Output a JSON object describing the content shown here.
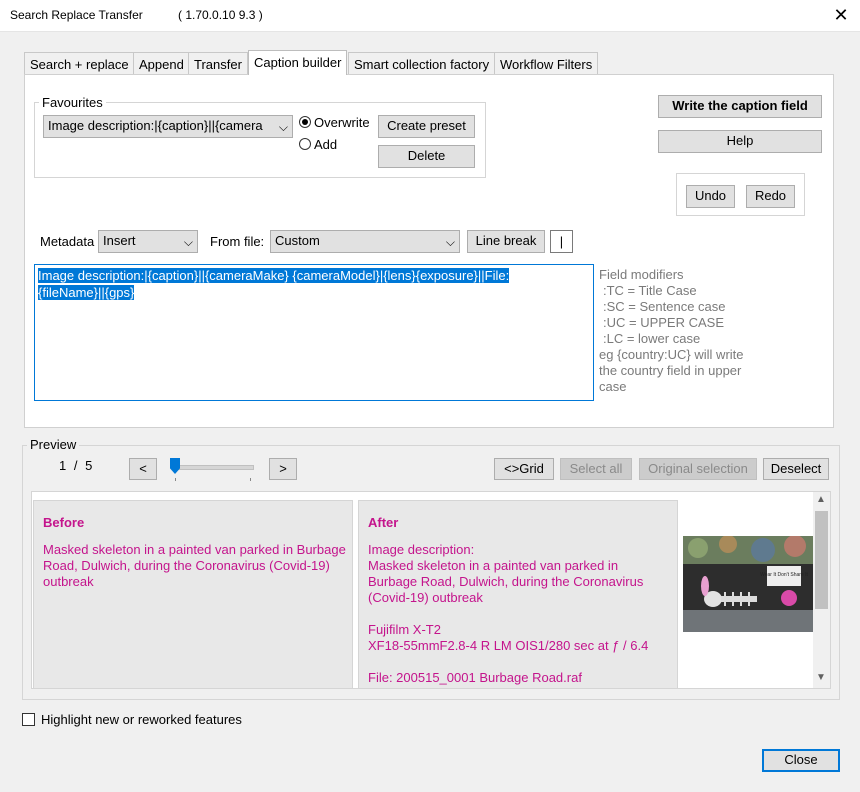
{
  "window": {
    "title": "Search Replace Transfer",
    "version": "( 1.70.0.10 9.3 )",
    "close_glyph": "✕"
  },
  "tabs": [
    {
      "label": "Search + replace"
    },
    {
      "label": "Append"
    },
    {
      "label": "Transfer"
    },
    {
      "label": "Caption builder",
      "active": true
    },
    {
      "label": "Smart collection factory"
    },
    {
      "label": "Workflow Filters"
    }
  ],
  "favourites": {
    "legend": "Favourites",
    "selected": "Image description:|{caption}||{camera",
    "overwrite_label": "Overwrite",
    "add_label": "Add",
    "create_preset": "Create preset",
    "delete": "Delete"
  },
  "actions": {
    "write_caption": "Write the caption field",
    "help": "Help",
    "undo": "Undo",
    "redo": "Redo"
  },
  "insert_row": {
    "metadata_label": "Metadata",
    "metadata_value": "Insert",
    "from_file_label": "From file:",
    "from_file_value": "Custom",
    "line_break": "Line break",
    "separator": "|"
  },
  "editor": {
    "line1": "Image description:|{caption}||{cameraMake} {cameraModel}|{lens}{exposure}||File:",
    "line2": "{fileName}||{gps}"
  },
  "modifiers": {
    "title": "Field modifiers",
    "tc": ":TC = Title Case",
    "sc": ":SC = Sentence case",
    "uc": ":UC = UPPER CASE",
    "lc": ":LC = lower case",
    "eg1": "eg {country:UC} will write",
    "eg2": "the country field in upper",
    "eg3": "case"
  },
  "preview": {
    "legend": "Preview",
    "current": "1",
    "slash": "/",
    "total": "5",
    "prev": "<",
    "next": ">",
    "slider_fraction": 0.0,
    "grid": "<>Grid",
    "select_all": "Select all",
    "original_selection": "Original selection",
    "deselect": "Deselect",
    "before_title": "Before",
    "before_text": "Masked skeleton in a painted van parked in Burbage Road, Dulwich, during the Coronavirus (Covid-19) outbreak",
    "after_title": "After",
    "after_l1": "Image description:",
    "after_l2": "Masked skeleton in a painted van parked in Burbage Road, Dulwich, during the Coronavirus (Covid-19) outbreak",
    "after_l3": "Fujifilm X-T2",
    "after_l4": "XF18-55mmF2.8-4 R LM OIS1/280 sec at ƒ / 6.4",
    "after_l5": "File: 200515_0001 Burbage Road.raf",
    "sign_text": "Wear It Don't Share It"
  },
  "footer": {
    "highlight_label": "Highlight new or reworked features",
    "close": "Close"
  }
}
